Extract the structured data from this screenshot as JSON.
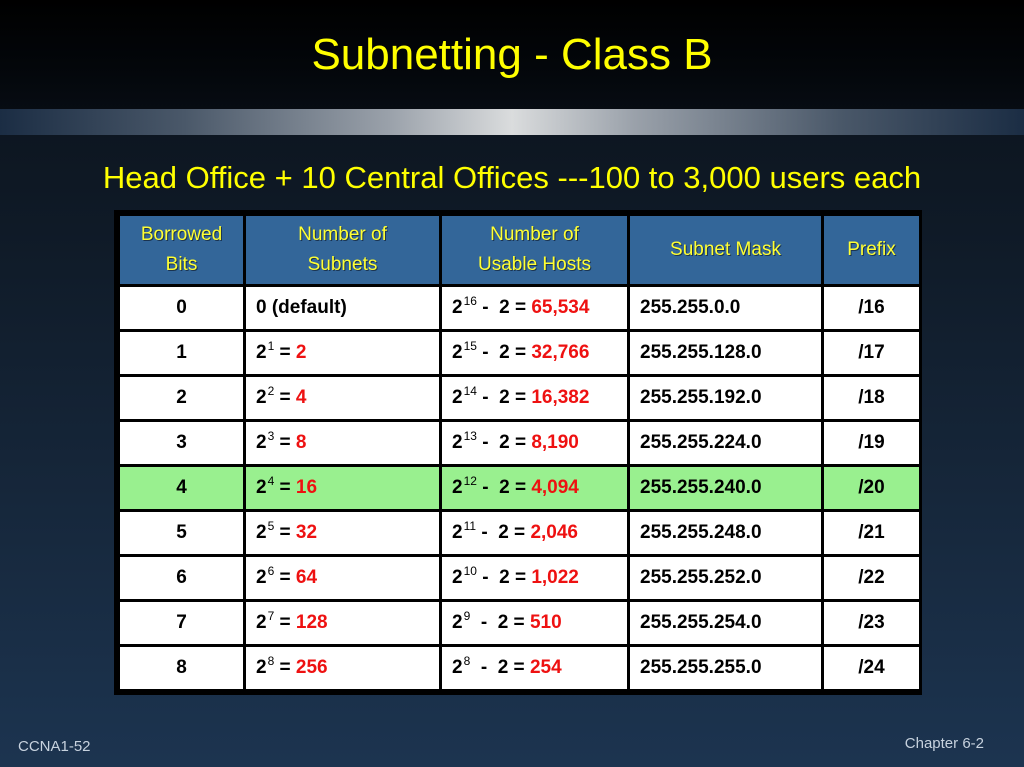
{
  "slide": {
    "title": "Subnetting - Class B",
    "subtitle": "Head Office + 10 Central Offices ---100 to 3,000 users each",
    "footer_left": "CCNA1-52",
    "footer_right": "Chapter 6-2",
    "colors": {
      "title": "#ffff00",
      "header_bg": "#336699",
      "header_text": "#ffff33",
      "highlight_row": "#99f08f",
      "result_red": "#ee1111"
    }
  },
  "table": {
    "headers": [
      {
        "line1": "Borrowed",
        "line2": "Bits"
      },
      {
        "line1": "Number of",
        "line2": "Subnets"
      },
      {
        "line1": "Number of",
        "line2": "Usable Hosts"
      },
      {
        "line1": "Subnet Mask",
        "line2": ""
      },
      {
        "line1": "Prefix",
        "line2": ""
      }
    ],
    "highlighted_row_index": 4,
    "rows": [
      {
        "bits": "0",
        "subnets_base": "0 (default)",
        "subnets_exp": "",
        "subnets_eq": "",
        "subnets_val": "",
        "hosts_base": "2",
        "hosts_exp": "16",
        "hosts_eq": " -  2 = ",
        "hosts_val": "65,534",
        "mask": "255.255.0.0",
        "prefix": "/16"
      },
      {
        "bits": "1",
        "subnets_base": "2",
        "subnets_exp": "1",
        "subnets_eq": " = ",
        "subnets_val": "2",
        "hosts_base": "2",
        "hosts_exp": "15",
        "hosts_eq": " -  2 = ",
        "hosts_val": "32,766",
        "mask": "255.255.128.0",
        "prefix": "/17"
      },
      {
        "bits": "2",
        "subnets_base": "2",
        "subnets_exp": "2",
        "subnets_eq": " = ",
        "subnets_val": "4",
        "hosts_base": "2",
        "hosts_exp": "14",
        "hosts_eq": " -  2 = ",
        "hosts_val": "16,382",
        "mask": "255.255.192.0",
        "prefix": "/18"
      },
      {
        "bits": "3",
        "subnets_base": "2",
        "subnets_exp": "3",
        "subnets_eq": " = ",
        "subnets_val": "8",
        "hosts_base": "2",
        "hosts_exp": "13",
        "hosts_eq": " -  2 = ",
        "hosts_val": "8,190",
        "mask": "255.255.224.0",
        "prefix": "/19"
      },
      {
        "bits": "4",
        "subnets_base": "2",
        "subnets_exp": "4",
        "subnets_eq": " = ",
        "subnets_val": "16",
        "hosts_base": "2",
        "hosts_exp": "12",
        "hosts_eq": " -  2 = ",
        "hosts_val": "4,094",
        "mask": "255.255.240.0",
        "prefix": "/20"
      },
      {
        "bits": "5",
        "subnets_base": "2",
        "subnets_exp": "5",
        "subnets_eq": " = ",
        "subnets_val": "32",
        "hosts_base": "2",
        "hosts_exp": "11",
        "hosts_eq": " -  2 = ",
        "hosts_val": "2,046",
        "mask": "255.255.248.0",
        "prefix": "/21"
      },
      {
        "bits": "6",
        "subnets_base": "2",
        "subnets_exp": "6",
        "subnets_eq": " = ",
        "subnets_val": "64",
        "hosts_base": "2",
        "hosts_exp": "10",
        "hosts_eq": " -  2 = ",
        "hosts_val": "1,022",
        "mask": "255.255.252.0",
        "prefix": "/22"
      },
      {
        "bits": "7",
        "subnets_base": "2",
        "subnets_exp": "7",
        "subnets_eq": " = ",
        "subnets_val": "128",
        "hosts_base": "2",
        "hosts_exp": "9",
        "hosts_eq": "  -  2 = ",
        "hosts_val": "510",
        "mask": "255.255.254.0",
        "prefix": "/23"
      },
      {
        "bits": "8",
        "subnets_base": "2",
        "subnets_exp": "8",
        "subnets_eq": " = ",
        "subnets_val": "256",
        "hosts_base": "2",
        "hosts_exp": "8",
        "hosts_eq": "  -  2 = ",
        "hosts_val": "254",
        "mask": "255.255.255.0",
        "prefix": "/24"
      }
    ]
  }
}
